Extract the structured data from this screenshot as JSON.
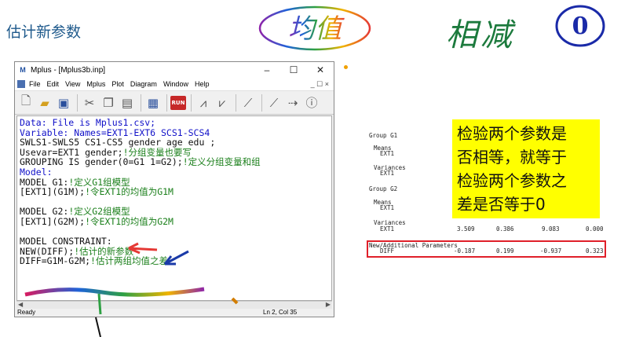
{
  "slide": {
    "title": "估计新参数"
  },
  "annotations": {
    "mean": "均值",
    "subtract": "相减",
    "zero": "0"
  },
  "window": {
    "title": "Mplus - [Mplus3b.inp]",
    "controls": [
      "–",
      "☐",
      "✕"
    ],
    "menu": [
      "File",
      "Edit",
      "View",
      "Mplus",
      "Plot",
      "Diagram",
      "Window",
      "Help"
    ],
    "menu_right": "_ ☐ ×",
    "toolbar_run_label": "RUN",
    "status_left": "Ready",
    "status_right": "Ln 2, Col 35"
  },
  "editor_lines": [
    {
      "text": "Data: File is Mplus1.csv;",
      "color": "blue"
    },
    {
      "text": "Variable: Names=EXT1-EXT6 SCS1-SCS4",
      "color": "blue"
    },
    {
      "text": "SWLS1-SWLS5 CS1-CS5 gender age edu ;",
      "color": "black"
    },
    {
      "text": "Usevar=EXT1 gender;!分组变量也要写",
      "color": "black"
    },
    {
      "text": "GROUPING IS gender(0=G1 1=G2);!定义分组变量和组",
      "color": "black"
    },
    {
      "text": "Model:",
      "color": "blue"
    },
    {
      "text": "MODEL G1:!定义G1组模型",
      "color": "black"
    },
    {
      "text": "[EXT1](G1M);!令EXT1的均值为G1M",
      "color": "black"
    },
    {
      "text": "",
      "color": "black"
    },
    {
      "text": "MODEL G2:!定义G2组模型",
      "color": "black"
    },
    {
      "text": "[EXT1](G2M);!令EXT1的均值为G2M",
      "color": "black"
    },
    {
      "text": "",
      "color": "black"
    },
    {
      "text": "MODEL CONSTRAINT:",
      "color": "black"
    },
    {
      "text": "NEW(DIFF);!估计的新参数",
      "color": "black"
    },
    {
      "text": "DIFF=G1M-G2M;!估计两组均值之差",
      "color": "black"
    }
  ],
  "output": {
    "group_g1": "Group G1",
    "means": "Means",
    "ext1": "EXT1",
    "variances": "Variances",
    "group_g2": "Group G2",
    "var_row": {
      "label": "EXT1",
      "estimate": "3.509",
      "se": "0.386",
      "est_se": "9.083",
      "pval": "0.000"
    },
    "new_params": "New/Additional Parameters",
    "diff_row": {
      "label": "DIFF",
      "estimate": "-0.187",
      "se": "0.199",
      "est_se": "-0.937",
      "pval": "0.323"
    }
  },
  "callout": {
    "lines": [
      "检验两个参数是",
      "否相等，就等于",
      "检验两个参数之",
      "差是否等于0"
    ]
  },
  "colors": {
    "title": "#1f5a8c",
    "callout_bg": "#ffff00",
    "diff_box": "#e0202a",
    "code_blue": "#1010c8",
    "code_green": "#1a7f1a"
  }
}
